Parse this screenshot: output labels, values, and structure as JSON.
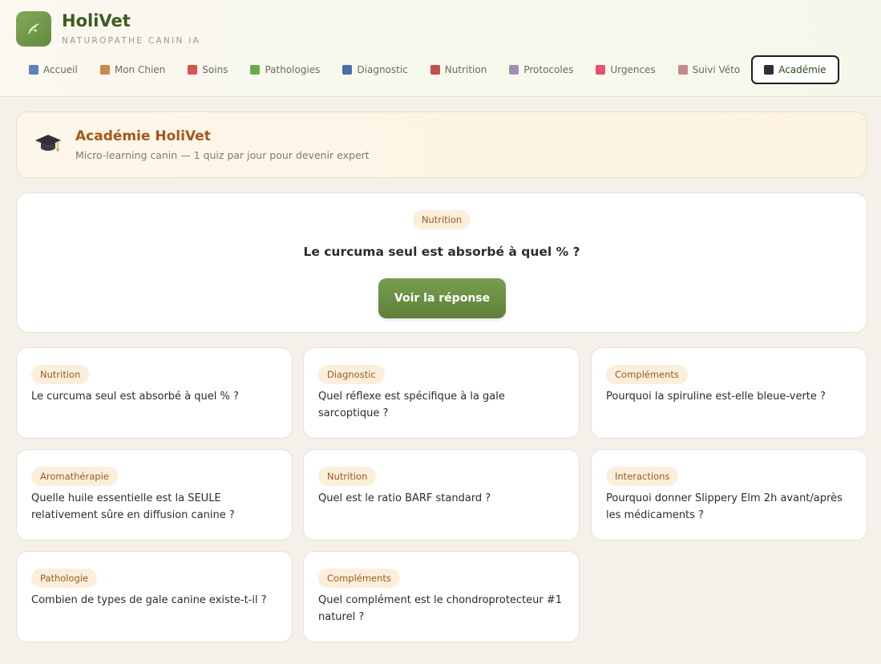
{
  "app": {
    "name": "HoliVet",
    "subtitle": "NATUROPATHE CANIN IA"
  },
  "nav": [
    {
      "label": "Accueil",
      "icon": "chart-icon",
      "color": "#5b7fbf"
    },
    {
      "label": "Mon Chien",
      "icon": "dog-icon",
      "color": "#c98a4a"
    },
    {
      "label": "Soins",
      "icon": "pill-icon",
      "color": "#d9534f"
    },
    {
      "label": "Pathologies",
      "icon": "microbe-icon",
      "color": "#6aa84f"
    },
    {
      "label": "Diagnostic",
      "icon": "stethoscope-icon",
      "color": "#4a6fa5"
    },
    {
      "label": "Nutrition",
      "icon": "meat-icon",
      "color": "#c0504d"
    },
    {
      "label": "Protocoles",
      "icon": "clipboard-icon",
      "color": "#a08fb0"
    },
    {
      "label": "Urgences",
      "icon": "alarm-icon",
      "color": "#e0556b"
    },
    {
      "label": "Suivi Véto",
      "icon": "clipboard-icon",
      "color": "#c48a8a"
    },
    {
      "label": "Académie",
      "icon": "graduation-cap-icon",
      "color": "#2f2f3a",
      "active": true
    }
  ],
  "banner": {
    "title": "Académie HoliVet",
    "subtitle": "Micro-learning canin — 1 quiz par jour pour devenir expert"
  },
  "quiz": {
    "category": "Nutrition",
    "question": "Le curcuma seul est absorbé à quel % ?",
    "button_label": "Voir la réponse"
  },
  "cards": [
    {
      "category": "Nutrition",
      "question": "Le curcuma seul est absorbé à quel % ?"
    },
    {
      "category": "Diagnostic",
      "question": "Quel réflexe est spécifique à la gale sarcoptique ?"
    },
    {
      "category": "Compléments",
      "question": "Pourquoi la spiruline est-elle bleue-verte ?"
    },
    {
      "category": "Aromathérapie",
      "question": "Quelle huile essentielle est la SEULE relativement sûre en diffusion canine ?"
    },
    {
      "category": "Nutrition",
      "question": "Quel est le ratio BARF standard ?"
    },
    {
      "category": "Interactions",
      "question": "Pourquoi donner Slippery Elm 2h avant/après les médicaments ?"
    },
    {
      "category": "Pathologie",
      "question": "Combien de types de gale canine existe-t-il ?"
    },
    {
      "category": "Compléments",
      "question": "Quel complément est le chondroprotecteur #1 naturel ?"
    }
  ]
}
